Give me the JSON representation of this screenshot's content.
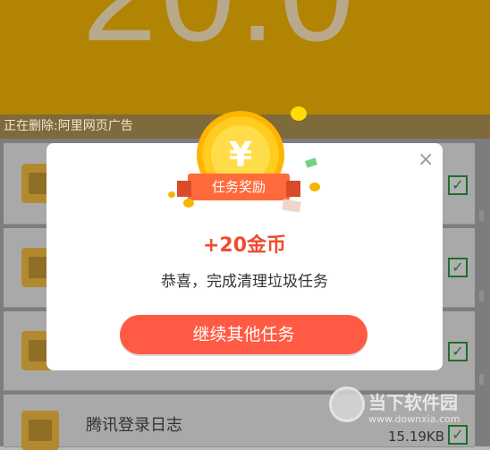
{
  "header": {
    "score_text": "20.0"
  },
  "status": {
    "deleting_text": "正在删除:阿里网页广告"
  },
  "list": {
    "rows": [
      {
        "title": "",
        "size": ""
      },
      {
        "title": "",
        "size": ""
      },
      {
        "title": "",
        "size": ""
      },
      {
        "title": "腾讯登录日志",
        "size": "15.19KB"
      }
    ]
  },
  "modal": {
    "badge_text": "任务奖励",
    "reward_text": "+20金币",
    "message": "恭喜，完成清理垃圾任务",
    "continue_button": "继续其他任务",
    "close_symbol": "×",
    "coin_symbol": "¥"
  },
  "watermark": {
    "brand_text": "当下软件园",
    "url_text": "www.downxia.com"
  },
  "colors": {
    "header_bg": "#b28404",
    "accent": "#ff5a43",
    "reward_text": "#ef4b2f",
    "check_green": "#1f6d2b"
  },
  "icons": {
    "close": "close-icon",
    "coin": "coin-icon",
    "folder": "folder-icon",
    "check": "checkbox-icon"
  }
}
